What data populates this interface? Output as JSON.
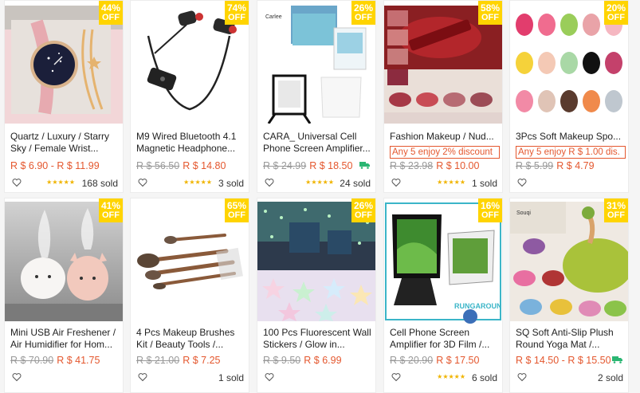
{
  "products": [
    {
      "discount": "44%",
      "off": "OFF",
      "title": "Quartz / Luxury / Starry Sky / Female Wrist...",
      "old_price": "",
      "price": "R $ 6.90 - R $ 11.99",
      "promo": "",
      "stars": "★★★★★",
      "sold": "168 sold",
      "image": "wristwatch-bracelet-image"
    },
    {
      "discount": "74%",
      "off": "OFF",
      "title": "M9 Wired Bluetooth 4.1 Magnetic Headphone...",
      "old_price": "R $ 56.50",
      "price": "R $ 14.80",
      "promo": "",
      "stars": "★★★★★",
      "sold": "3 sold",
      "image": "bluetooth-headphone-image"
    },
    {
      "discount": "26%",
      "off": "OFF",
      "title": "CARA_ Universal Cell Phone Screen Amplifier...",
      "old_price": "R $ 24.99",
      "price": "R $ 18.50",
      "promo": "",
      "stars": "★★★★★",
      "sold": "24 sold",
      "image": "screen-amplifier-image",
      "free_ship": true
    },
    {
      "discount": "58%",
      "off": "OFF",
      "title": "Fashion Makeup / Nud...",
      "old_price": "R $ 23.98",
      "price": "R $ 10.00",
      "promo": "Any 5 enjoy 2% discount",
      "stars": "★★★★★",
      "sold": "1 sold",
      "image": "lipstick-image"
    },
    {
      "discount": "20%",
      "off": "OFF",
      "title": "3Pcs Soft Makeup Spo...",
      "old_price": "R $ 5.99",
      "price": "R $ 4.79",
      "promo": "Any 5 enjoy R $ 1.00 dis.",
      "stars": "",
      "sold": "",
      "image": "makeup-sponge-image"
    },
    {
      "discount": "41%",
      "off": "OFF",
      "title": "Mini USB Air Freshener / Air Humidifier for Hom...",
      "old_price": "R $ 70.90",
      "price": "R $ 41.75",
      "promo": "",
      "stars": "",
      "sold": "",
      "image": "humidifier-image"
    },
    {
      "discount": "65%",
      "off": "OFF",
      "title": "4 Pcs Makeup Brushes Kit / Beauty Tools /...",
      "old_price": "R $ 21.00",
      "price": "R $ 7.25",
      "promo": "",
      "stars": "",
      "sold": "1 sold",
      "image": "makeup-brushes-image"
    },
    {
      "discount": "26%",
      "off": "OFF",
      "title": "100 Pcs Fluorescent Wall Stickers / Glow in...",
      "old_price": "R $ 9.50",
      "price": "R $ 6.99",
      "promo": "",
      "stars": "",
      "sold": "",
      "image": "glow-stars-image"
    },
    {
      "discount": "16%",
      "off": "OFF",
      "title": "Cell Phone Screen Amplifier for 3D Film /...",
      "old_price": "R $ 20.90",
      "price": "R $ 17.50",
      "promo": "",
      "stars": "★★★★★",
      "sold": "6 sold",
      "image": "phone-amplifier-image"
    },
    {
      "discount": "31%",
      "off": "OFF",
      "title": "SQ Soft Anti-Slip Plush Round Yoga Mat /...",
      "old_price": "",
      "price": "R $ 14.50 - R $ 15.50",
      "promo": "",
      "stars": "",
      "sold": "2 sold",
      "image": "round-rug-image",
      "free_ship": true
    }
  ],
  "image_text": {
    "brand_caption": "Carlee",
    "watermark": "RUNGAROUN",
    "sponge_box": "Souqi"
  },
  "colors": {
    "badge": "#ffd400",
    "price": "#e4572e",
    "stars": "#f0b400",
    "ship": "#2bb673"
  }
}
